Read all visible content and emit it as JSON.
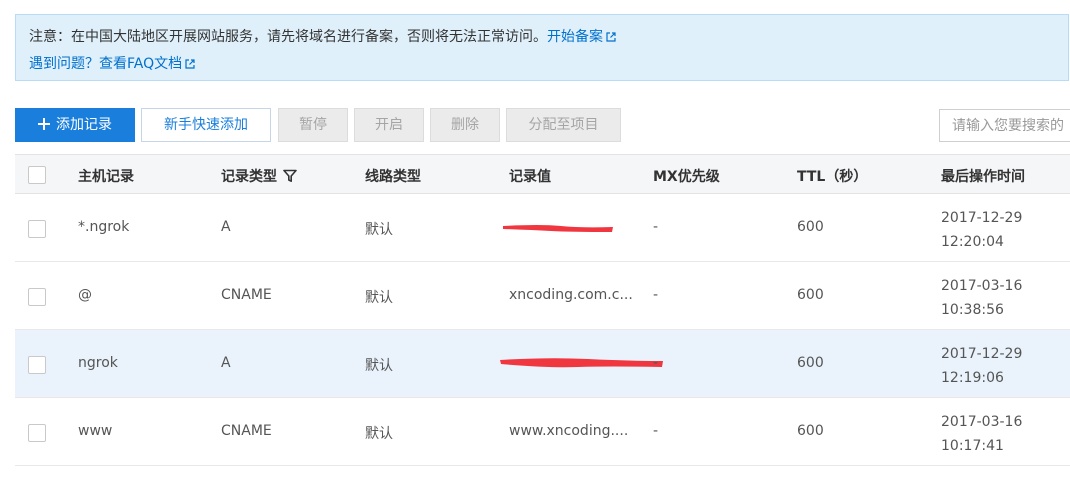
{
  "notice": {
    "text": "注意：在中国大陆地区开展网站服务，请先将域名进行备案，否则将无法正常访问。",
    "link1": "开始备案",
    "text2": "遇到问题？查看FAQ文档"
  },
  "toolbar": {
    "add_record": "添加记录",
    "quick_add": "新手快速添加",
    "pause": "暂停",
    "enable": "开启",
    "delete": "删除",
    "assign_project": "分配至项目",
    "search_placeholder": "请输入您要搜索的"
  },
  "table": {
    "headers": {
      "host": "主机记录",
      "type": "记录类型",
      "line": "线路类型",
      "value": "记录值",
      "mx": "MX优先级",
      "ttl": "TTL（秒）",
      "time": "最后操作时间"
    },
    "rows": [
      {
        "host": "*.ngrok",
        "type": "A",
        "line": "默认",
        "value": "",
        "value_redacted": true,
        "mx": "-",
        "ttl": "600",
        "date": "2017-12-29",
        "time": "12:20:04"
      },
      {
        "host": "@",
        "type": "CNAME",
        "line": "默认",
        "value": "xncoding.com.c...",
        "value_redacted": false,
        "mx": "-",
        "ttl": "600",
        "date": "2017-03-16",
        "time": "10:38:56"
      },
      {
        "host": "ngrok",
        "type": "A",
        "line": "默认",
        "value": "",
        "value_redacted": true,
        "mx": "-",
        "ttl": "600",
        "date": "2017-12-29",
        "time": "12:19:06"
      },
      {
        "host": "www",
        "type": "CNAME",
        "line": "默认",
        "value": "www.xncoding....",
        "value_redacted": false,
        "mx": "-",
        "ttl": "600",
        "date": "2017-03-16",
        "time": "10:17:41"
      }
    ]
  },
  "colors": {
    "primary": "#1a7fdc",
    "link": "#0070cc",
    "notice_bg": "#dff0fb",
    "redaction": "#f0363f",
    "row_highlight": "#eaf3fb"
  },
  "icons": [
    "plus-icon",
    "external-link-icon",
    "filter-icon"
  ]
}
